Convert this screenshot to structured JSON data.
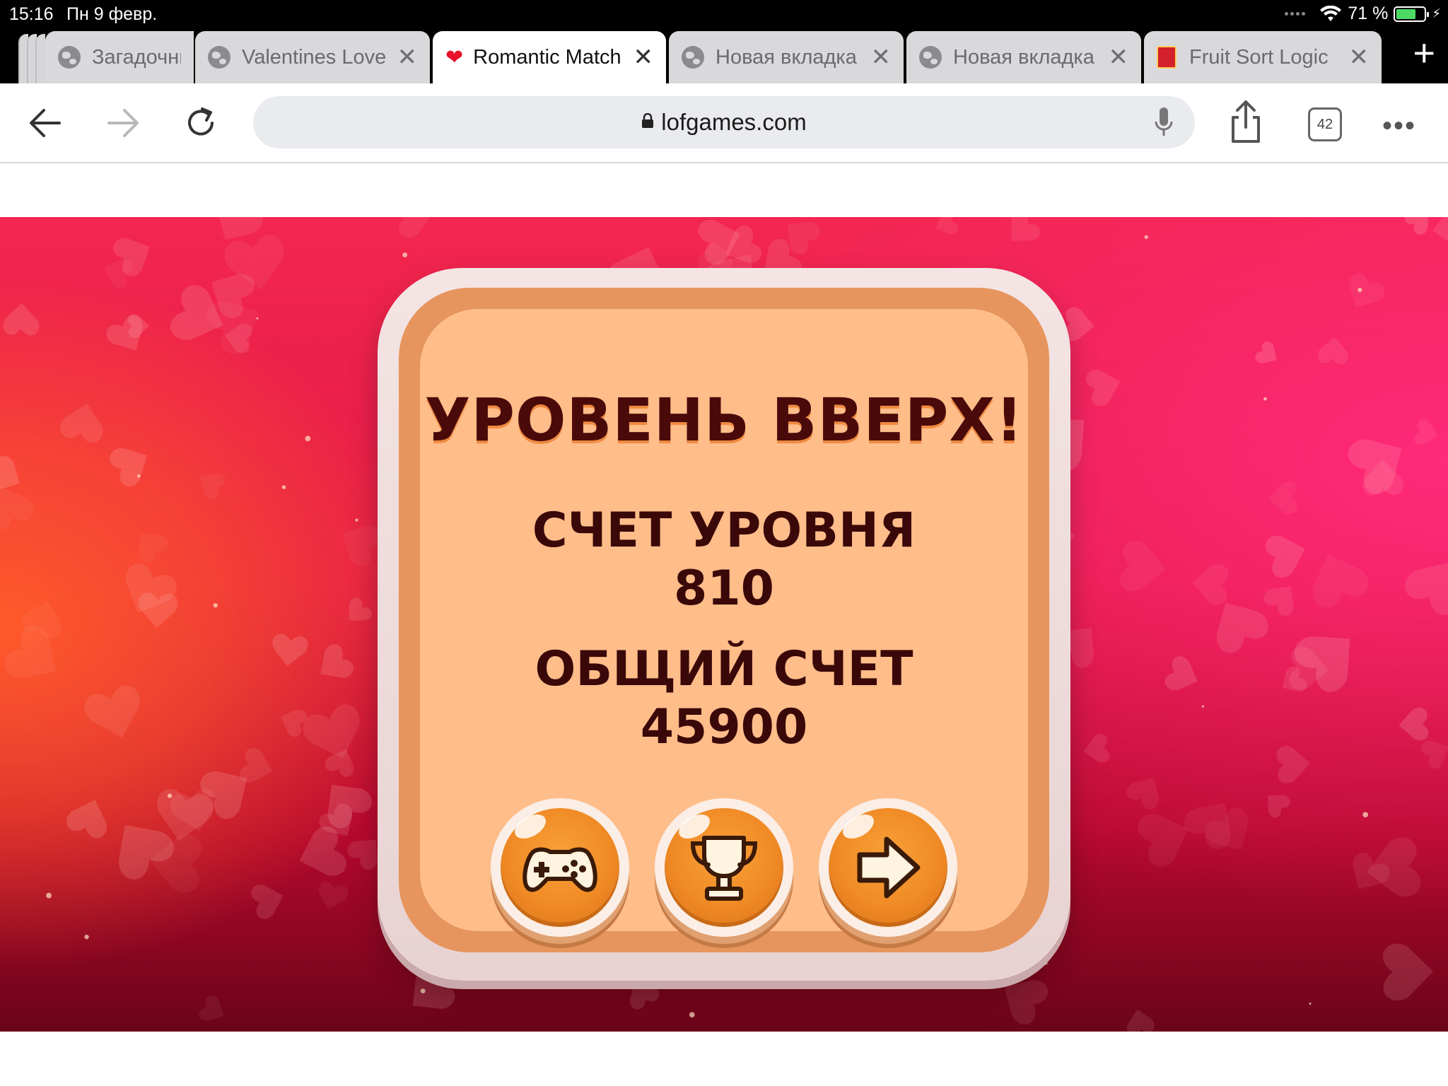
{
  "status_bar": {
    "time": "15:16",
    "date": "Пн 9 февр.",
    "battery": "71 %",
    "battery_level": 0.71
  },
  "tabs": [
    {
      "label": "Загадочны",
      "favicon": "globe-icon",
      "closable": false
    },
    {
      "label": "Valentines Love",
      "favicon": "globe-icon",
      "closable": true
    },
    {
      "label": "Romantic Match",
      "favicon": "heart-icon",
      "closable": true,
      "active": true
    },
    {
      "label": "Новая вкладка",
      "favicon": "globe-icon",
      "closable": true
    },
    {
      "label": "Новая вкладка",
      "favicon": "globe-icon",
      "closable": true
    },
    {
      "label": "Fruit Sort Logic",
      "favicon": "fruit-icon",
      "closable": true
    }
  ],
  "toolbar": {
    "url": "lofgames.com",
    "tabs_count": "42"
  },
  "game": {
    "title": "УРОВЕНЬ ВВЕРХ!",
    "level_score_label": "СЧЕТ УРОВНЯ",
    "level_score": "810",
    "total_score_label": "ОБЩИЙ СЧЕТ",
    "total_score": "45900",
    "buttons": [
      {
        "name": "more-games-button",
        "icon": "gamepad-icon"
      },
      {
        "name": "leaderboard-button",
        "icon": "trophy-icon"
      },
      {
        "name": "next-level-button",
        "icon": "arrow-right-icon"
      }
    ]
  },
  "colors": {
    "panel_fill": "#ffbd8a",
    "panel_border": "#e6955e",
    "text_dark": "#3a0808",
    "button_orange": "#f08a24",
    "background_red": "#e41a48"
  }
}
